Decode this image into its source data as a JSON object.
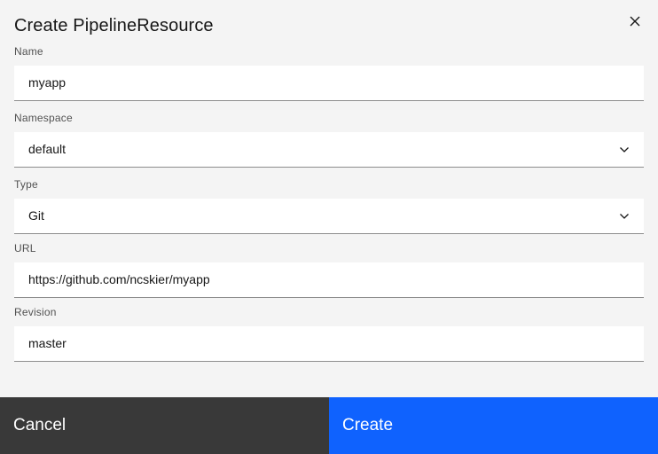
{
  "dialog": {
    "title": "Create PipelineResource",
    "close_icon": "close-icon"
  },
  "form": {
    "name": {
      "label": "Name",
      "value": "myapp"
    },
    "namespace": {
      "label": "Namespace",
      "value": "default",
      "icon": "chevron-down-icon"
    },
    "type": {
      "label": "Type",
      "value": "Git",
      "icon": "chevron-down-icon"
    },
    "url": {
      "label": "URL",
      "value": "https://github.com/ncskier/myapp"
    },
    "revision": {
      "label": "Revision",
      "value": "master"
    }
  },
  "footer": {
    "cancel_label": "Cancel",
    "create_label": "Create"
  },
  "colors": {
    "background": "#f4f4f4",
    "field_background": "#ffffff",
    "field_border": "#8d8d8d",
    "secondary_button": "#393939",
    "primary_button": "#0f62fe",
    "label_text": "#525252",
    "text": "#161616"
  }
}
